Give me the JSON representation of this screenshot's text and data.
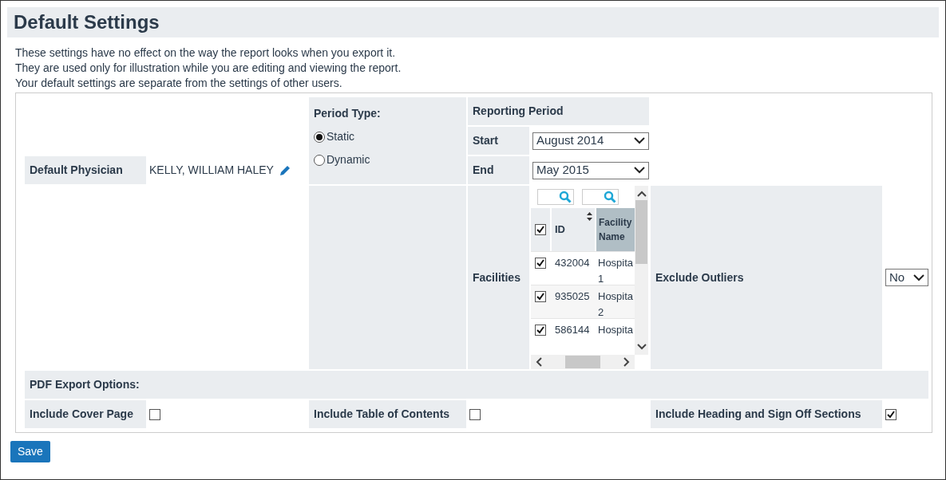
{
  "title": "Default Settings",
  "intro": [
    "These settings have no effect on the way the report looks when you export it.",
    "They are used only for illustration while you are editing and viewing the report.",
    "Your default settings are separate from the settings of other users."
  ],
  "physician": {
    "label": "Default Physician",
    "value": "KELLY, WILLIAM HALEY"
  },
  "period_type": {
    "label": "Period Type:",
    "options": [
      {
        "label": "Static",
        "selected": true
      },
      {
        "label": "Dynamic",
        "selected": false
      }
    ]
  },
  "reporting_period": {
    "label": "Reporting Period",
    "start": {
      "label": "Start",
      "value": "August 2014"
    },
    "end": {
      "label": "End",
      "value": "May 2015"
    }
  },
  "facilities": {
    "label": "Facilities",
    "all_checked": true,
    "columns": [
      "ID",
      "Facility Name"
    ],
    "rows": [
      {
        "id": "432004",
        "name": "Hospita 1",
        "checked": true
      },
      {
        "id": "935025",
        "name": "Hospita 2",
        "checked": true
      },
      {
        "id": "586144",
        "name": "Hospita",
        "checked": true
      }
    ]
  },
  "exclude_outliers": {
    "label": "Exclude Outliers",
    "value": "No"
  },
  "pdf_export": {
    "label": "PDF Export Options:",
    "options": [
      {
        "label": "Include Cover Page",
        "checked": false
      },
      {
        "label": "Include Table of Contents",
        "checked": false
      },
      {
        "label": "Include Heading and Sign Off Sections",
        "checked": true
      }
    ]
  },
  "save": "Save"
}
